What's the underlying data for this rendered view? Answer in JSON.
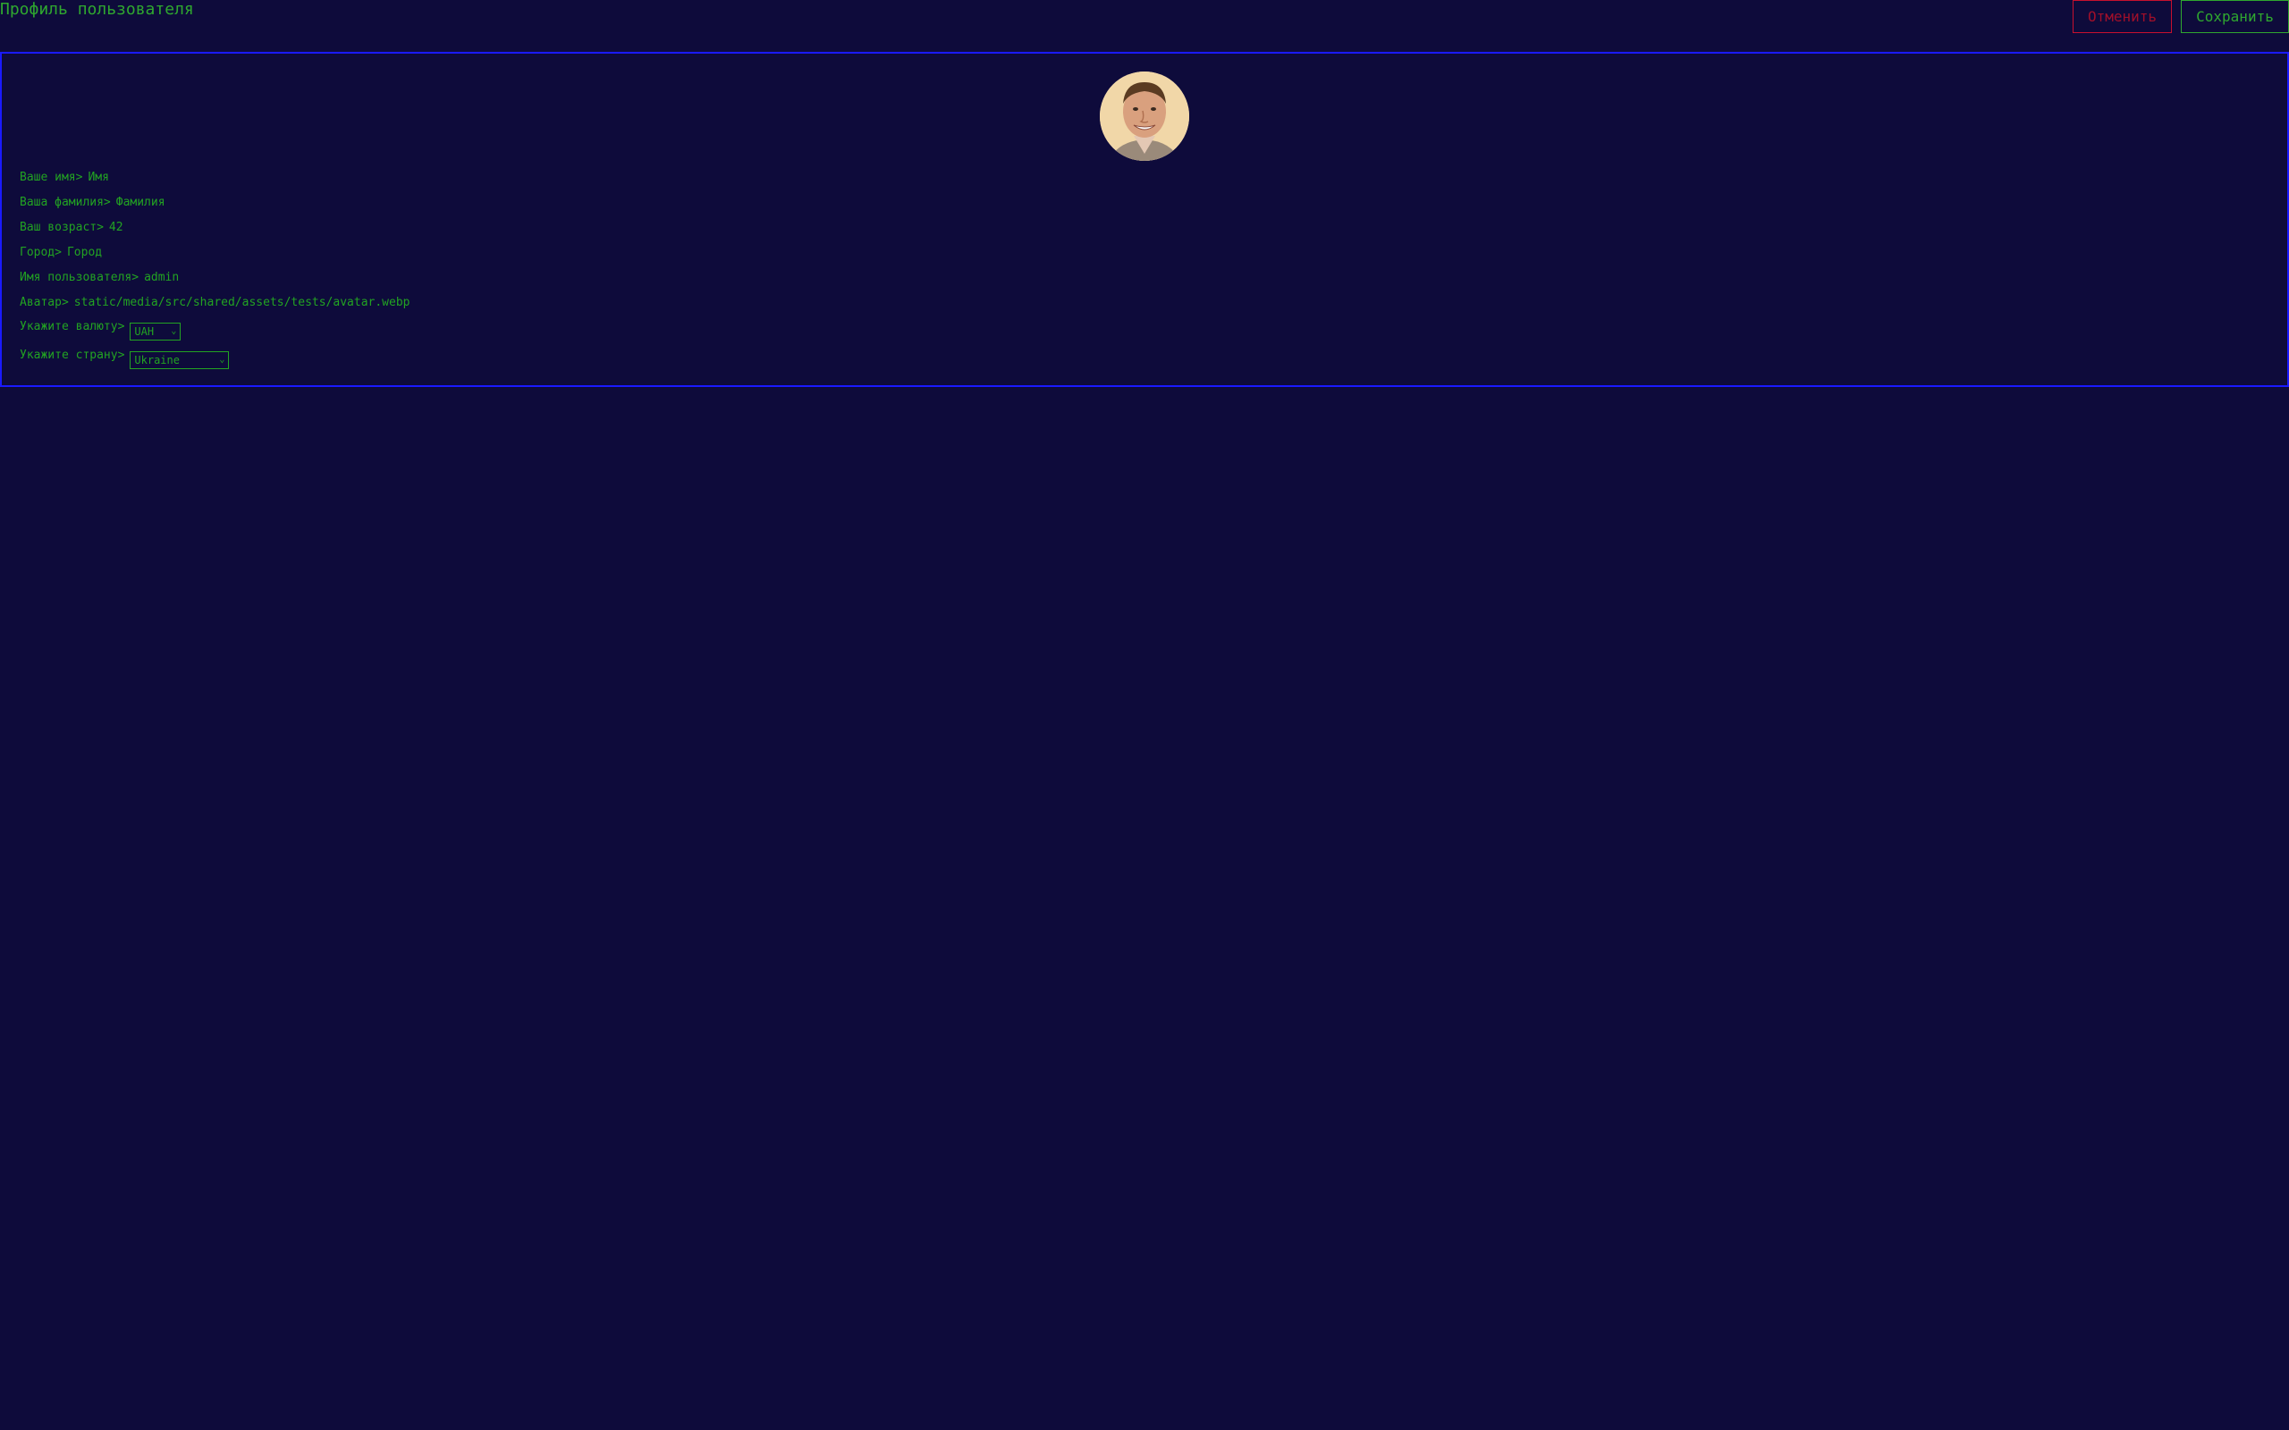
{
  "header": {
    "title": "Профиль пользователя",
    "cancel_label": "Отменить",
    "save_label": "Сохранить"
  },
  "profile": {
    "fields": [
      {
        "label": "Ваше имя>",
        "value": "Имя"
      },
      {
        "label": "Ваша фамилия>",
        "value": "Фамилия"
      },
      {
        "label": "Ваш возраст>",
        "value": "42"
      },
      {
        "label": "Город>",
        "value": "Город"
      },
      {
        "label": "Имя пользователя>",
        "value": "admin"
      },
      {
        "label": "Аватар>",
        "value": "static/media/src/shared/assets/tests/avatar.webp"
      }
    ],
    "currency": {
      "label": "Укажите валюту>",
      "selected": "UAH"
    },
    "country": {
      "label": "Укажите страну>",
      "selected": "Ukraine"
    }
  },
  "colors": {
    "background": "#0e0b3b",
    "text": "#22a322",
    "card_border": "#1a1aff",
    "cancel": "#c8102e"
  },
  "icons": {
    "select_chevron": "chevron-down-icon"
  }
}
